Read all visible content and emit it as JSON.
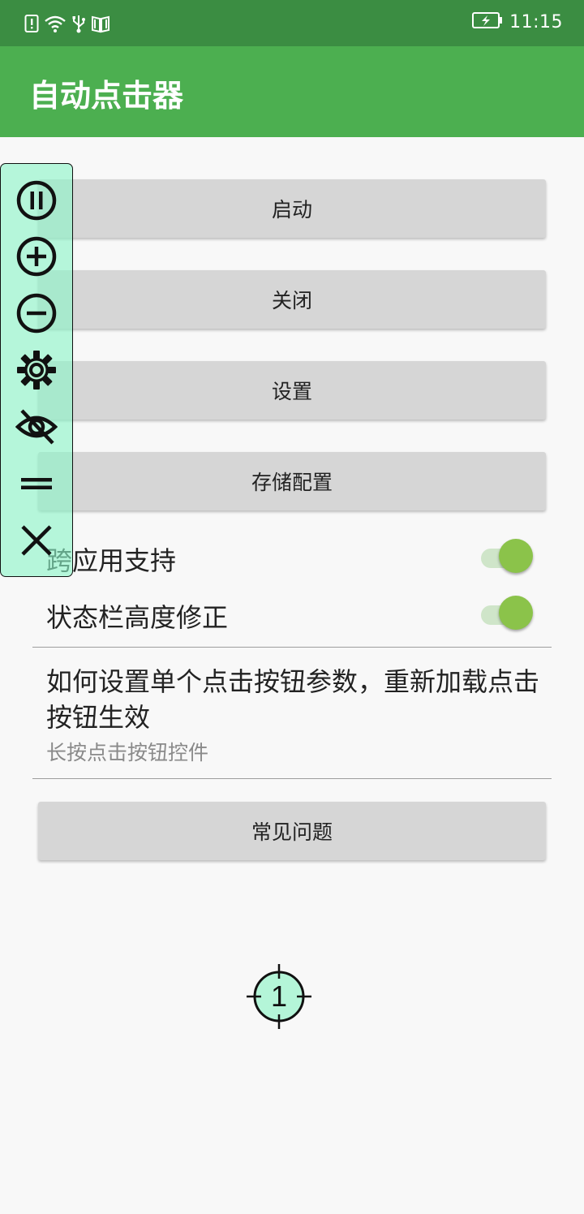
{
  "status_bar": {
    "time": "11:15",
    "icons": [
      "alert-icon",
      "wifi-icon",
      "usb-icon",
      "book-icon"
    ],
    "battery_icon": "battery-charging-icon"
  },
  "app_bar": {
    "title": "自动点击器"
  },
  "buttons": {
    "start": "启动",
    "close": "关闭",
    "settings": "设置",
    "save_config": "存储配置",
    "faq": "常见问题"
  },
  "toggles": [
    {
      "label": "跨应用支持",
      "checked": true
    },
    {
      "label": "状态栏高度修正",
      "checked": true
    }
  ],
  "help": {
    "title": "如何设置单个点击按钮参数，重新加载点击按钮生效",
    "subtitle": "长按点击按钮控件"
  },
  "floating_toolbar": {
    "icons": [
      "pause-icon",
      "add-icon",
      "remove-icon",
      "settings-icon",
      "hide-icon",
      "drag-handle-icon",
      "close-icon"
    ]
  },
  "click_target": {
    "number": "1"
  },
  "colors": {
    "status_bar": "#3b8d42",
    "app_bar": "#4caf50",
    "switch_thumb": "#8bc34a",
    "switch_track": "#cfe5c9",
    "floating_toolbar": "#8cf5c8",
    "target_fill": "#b4f5d8"
  }
}
